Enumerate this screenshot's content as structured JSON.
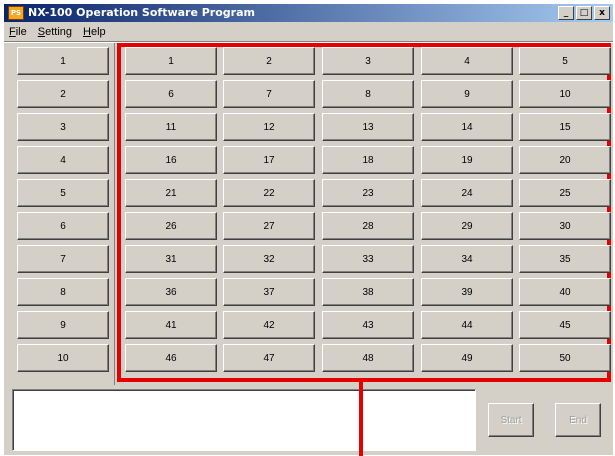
{
  "window": {
    "title": "NX-100 Operation Software Program",
    "icon_text": "PS",
    "controls": [
      "_",
      "□",
      "x"
    ]
  },
  "menu": [
    {
      "mnemonic": "F",
      "rest": "ile"
    },
    {
      "mnemonic": "S",
      "rest": "etting"
    },
    {
      "mnemonic": "H",
      "rest": "elp"
    }
  ],
  "left_buttons": [
    "1",
    "2",
    "3",
    "4",
    "5",
    "6",
    "7",
    "8",
    "9",
    "10"
  ],
  "grid_buttons": [
    "1",
    "2",
    "3",
    "4",
    "5",
    "6",
    "7",
    "8",
    "9",
    "10",
    "11",
    "12",
    "13",
    "14",
    "15",
    "16",
    "17",
    "18",
    "19",
    "20",
    "21",
    "22",
    "23",
    "24",
    "25",
    "26",
    "27",
    "28",
    "29",
    "30",
    "31",
    "32",
    "33",
    "34",
    "35",
    "36",
    "37",
    "38",
    "39",
    "40",
    "41",
    "42",
    "43",
    "44",
    "45",
    "46",
    "47",
    "48",
    "49",
    "50"
  ],
  "grid_columns": 5,
  "actions": {
    "start_label": "Start",
    "end_label": "End",
    "start_enabled": false,
    "end_enabled": false
  },
  "log": {
    "value": ""
  },
  "colors": {
    "highlight": "#e60000",
    "face": "#d4d0c8"
  }
}
